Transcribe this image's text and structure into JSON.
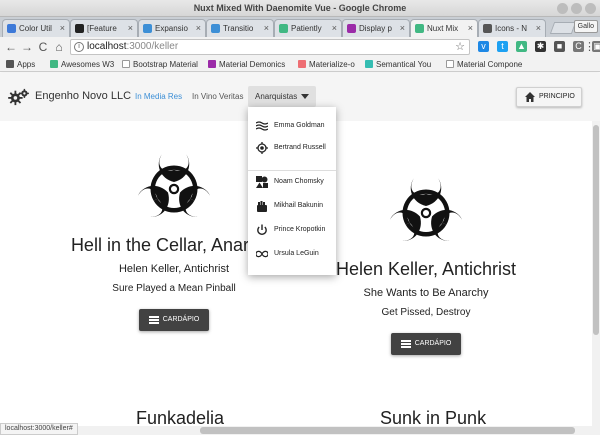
{
  "window": {
    "title": "Nuxt Mixed With Daenomite Vue - Google Chrome"
  },
  "tabs": [
    {
      "label": "Color Util",
      "color": "#3d79d8"
    },
    {
      "label": "[Feature",
      "color": "#222222"
    },
    {
      "label": "Expansio",
      "color": "#3d8fd6"
    },
    {
      "label": "Transitio",
      "color": "#3d8fd6"
    },
    {
      "label": "Patiently",
      "color": "#41b883"
    },
    {
      "label": "Display p",
      "color": "#9b2ba8"
    },
    {
      "label": "Nuxt Mix",
      "color": "#41b883"
    },
    {
      "label": "Icons - N",
      "color": "#555555"
    }
  ],
  "profile_chip": "Gallo",
  "address": {
    "host": "localhost",
    "path": ":3000/keller"
  },
  "bookmarks": [
    {
      "label": "Apps",
      "color": "#555555"
    },
    {
      "label": "Awesomes W3",
      "color": "#41b883"
    },
    {
      "label": "Bootstrap Material",
      "color": "#999999"
    },
    {
      "label": "Material Demonics",
      "color": "#9b2ba8"
    },
    {
      "label": "Materialize-o",
      "color": "#ee6e73"
    },
    {
      "label": "Semantical You",
      "color": "#35bdb2"
    },
    {
      "label": "Material Compone",
      "color": "#999999"
    }
  ],
  "appbar": {
    "brand": "Engenho Novo LLC",
    "links": [
      "In Media Res",
      "In Vino Veritas"
    ],
    "dropdown_label": "Anarquistas",
    "home_label": "PRINCIPIO"
  },
  "dropdown_items": [
    {
      "label": "Emma Goldman",
      "icon": "waves-icon"
    },
    {
      "label": "Bertrand Russell",
      "icon": "crosshair-icon"
    },
    {
      "label": "Noam Chomsky",
      "icon": "shapes-icon"
    },
    {
      "label": "Mikhail Bakunin",
      "icon": "fist-icon"
    },
    {
      "label": "Prince Kropotkin",
      "icon": "power-icon"
    },
    {
      "label": "Ursula LeGuin",
      "icon": "infinity-icon"
    }
  ],
  "cards": [
    {
      "title": "Hell in the Cellar, Anarchy",
      "subtitle": "Helen Keller, Antichrist",
      "desc": "Sure Played a Mean Pinball",
      "button": "CARDÁPIO"
    },
    {
      "title": "Helen Keller, Antichrist",
      "subtitle": "She Wants to Be Anarchy",
      "desc": "Get Pissed, Destroy",
      "button": "CARDÁPIO"
    }
  ],
  "next_titles": [
    "Funkadelia",
    "Sunk in Punk"
  ],
  "status_url": "localhost:3000/keller#"
}
